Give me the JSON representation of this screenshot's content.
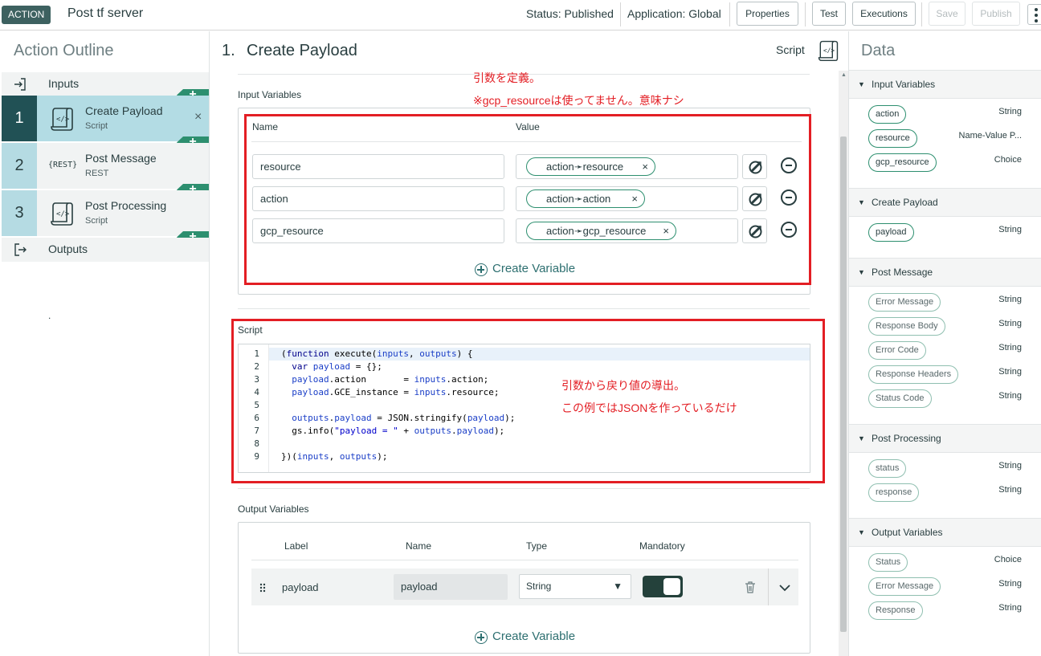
{
  "header": {
    "badge": "ACTION",
    "title": "Post tf server",
    "status": "Status: Published",
    "application": "Application: Global",
    "buttons": {
      "properties": "Properties",
      "test": "Test",
      "executions": "Executions",
      "save": "Save",
      "publish": "Publish"
    }
  },
  "outline": {
    "title": "Action Outline",
    "inputs": "Inputs",
    "outputs": "Outputs",
    "dot": ".",
    "plus": "+",
    "close": "×",
    "steps": [
      {
        "num": "1",
        "name": "Create Payload",
        "type": "Script"
      },
      {
        "num": "2",
        "name": "Post Message",
        "type": "REST",
        "icon_text": "{REST}"
      },
      {
        "num": "3",
        "name": "Post Processing",
        "type": "Script"
      }
    ]
  },
  "center": {
    "title_num": "1.",
    "title": "Create Payload",
    "script_label": "Script",
    "input_vars_label": "Input Variables",
    "col_name": "Name",
    "col_value": "Value",
    "rows": [
      {
        "name": "resource",
        "value": "action➛resource"
      },
      {
        "name": "action",
        "value": "action➛action"
      },
      {
        "name": "gcp_resource",
        "value": "action➛gcp_resource"
      }
    ],
    "pill_x": "×",
    "create_variable": "Create Variable",
    "script_section_label": "Script",
    "notes": {
      "note1": "引数を定義。",
      "note2": "※gcp_resourceは使ってません。意味ナシ",
      "note3": "引数から戻り値の導出。",
      "note4": "この例ではJSONを作っているだけ"
    },
    "code_lines": [
      {
        "n": "1",
        "t": "(function execute(inputs, outputs) {"
      },
      {
        "n": "2",
        "t": "  var payload = {};"
      },
      {
        "n": "3",
        "t": "  payload.action       = inputs.action;"
      },
      {
        "n": "4",
        "t": "  payload.GCE_instance = inputs.resource;"
      },
      {
        "n": "5",
        "t": ""
      },
      {
        "n": "6",
        "t": "  outputs.payload = JSON.stringify(payload);"
      },
      {
        "n": "7",
        "t": "  gs.info(\"payload = \" + outputs.payload);"
      },
      {
        "n": "8",
        "t": ""
      },
      {
        "n": "9",
        "t": "})(inputs, outputs);"
      }
    ],
    "output_vars_label": "Output Variables",
    "out_cols": {
      "label": "Label",
      "name": "Name",
      "type": "Type",
      "mandatory": "Mandatory"
    },
    "out_row": {
      "label": "payload",
      "name": "payload",
      "type": "String",
      "mandatory": true
    },
    "create_variable_2": "Create Variable"
  },
  "data_panel": {
    "title": "Data",
    "sections": [
      {
        "title": "Input Variables",
        "items": [
          {
            "pill": "action",
            "type": "String"
          },
          {
            "pill": "resource",
            "type": "Name-Value P..."
          },
          {
            "pill": "gcp_resource",
            "type": "Choice"
          }
        ]
      },
      {
        "title": "Create Payload",
        "items": [
          {
            "pill": "payload",
            "type": "String"
          }
        ]
      },
      {
        "title": "Post Message",
        "items": [
          {
            "pill": "Error Message",
            "type": "String"
          },
          {
            "pill": "Response Body",
            "type": "String"
          },
          {
            "pill": "Error Code",
            "type": "String"
          },
          {
            "pill": "Response Headers",
            "type": "String"
          },
          {
            "pill": "Status Code",
            "type": "String"
          }
        ]
      },
      {
        "title": "Post Processing",
        "items": [
          {
            "pill": "status",
            "type": "String"
          },
          {
            "pill": "response",
            "type": "String"
          }
        ]
      },
      {
        "title": "Output Variables",
        "items": [
          {
            "pill": "Status",
            "type": "Choice"
          },
          {
            "pill": "Error Message",
            "type": "String"
          },
          {
            "pill": "Response",
            "type": "String"
          }
        ]
      }
    ]
  },
  "colors": {
    "accent": "#2d8f6f",
    "active_step": "#215155",
    "annotation_red": "#e31e24",
    "badge_bg": "#3d6160"
  },
  "icons": [
    "step-in-icon",
    "step-out-icon",
    "script-icon",
    "rest-icon",
    "close-icon",
    "plus-icon",
    "datapill-picker-icon",
    "remove-icon",
    "add-circle-icon",
    "drag-handle-icon",
    "trash-icon",
    "chevron-down-icon",
    "triangle-down-icon",
    "kebab-icon"
  ]
}
